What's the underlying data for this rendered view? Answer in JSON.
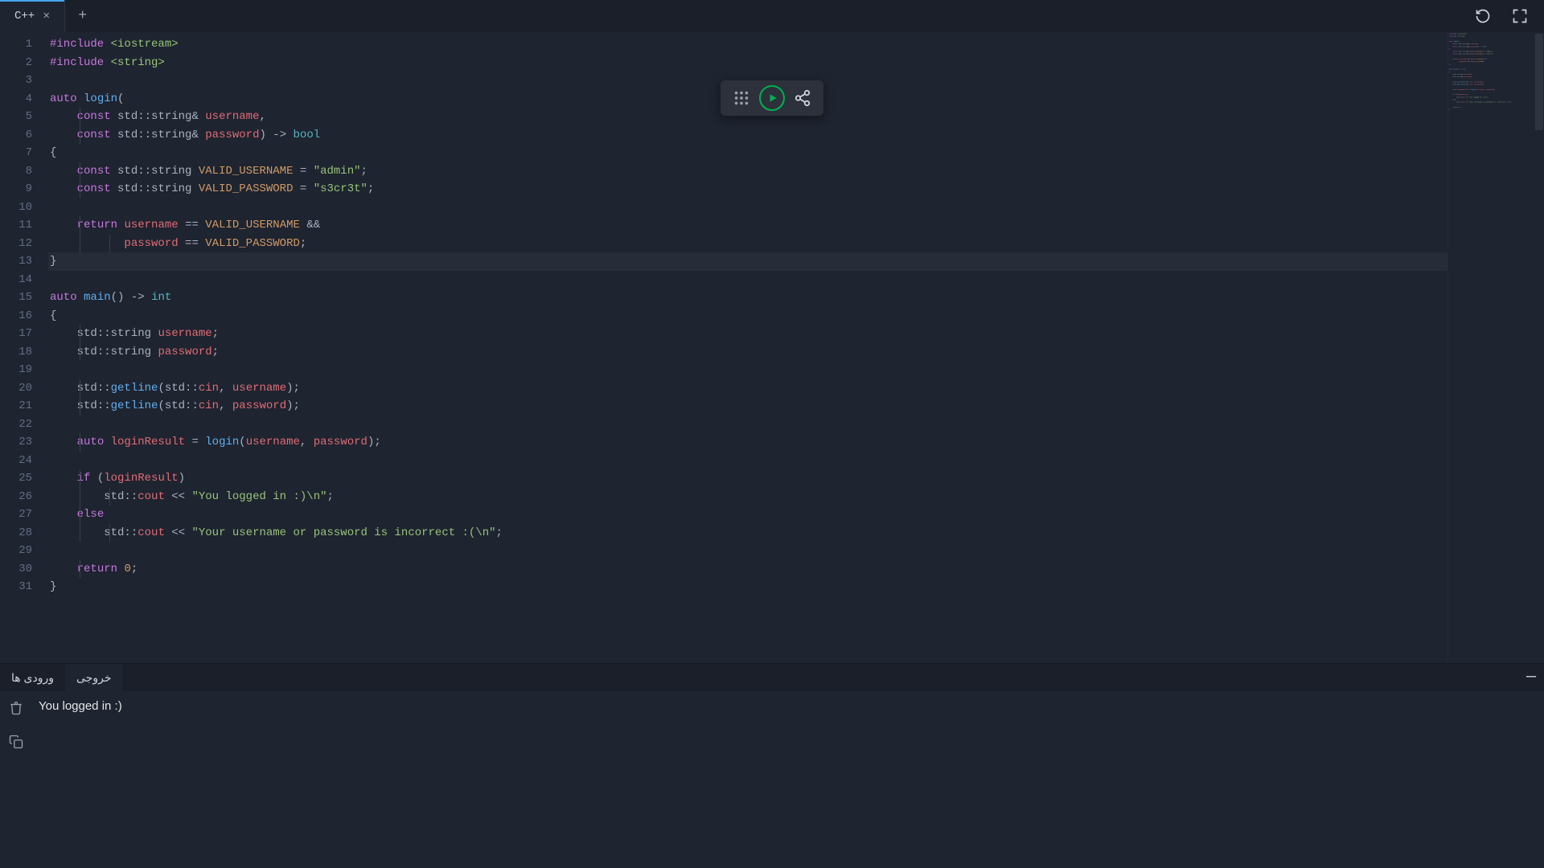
{
  "tabs": {
    "active": {
      "title": "C++"
    },
    "add_tooltip": "New Tab"
  },
  "toolbar": {
    "reload": "reload",
    "fullscreen": "fullscreen"
  },
  "float_actions": {
    "apps": "apps",
    "run": "run",
    "share": "share"
  },
  "panel": {
    "tab_inputs": "ورودی ها",
    "tab_output": "خروجی",
    "output_text": "You logged in :)"
  },
  "code": {
    "total_lines": 31,
    "current_line": 13,
    "lines": [
      [
        {
          "c": "tok-preproc",
          "t": "#include"
        },
        {
          "c": "",
          "t": " "
        },
        {
          "c": "tok-include-lib",
          "t": "<iostream>"
        }
      ],
      [
        {
          "c": "tok-preproc",
          "t": "#include"
        },
        {
          "c": "",
          "t": " "
        },
        {
          "c": "tok-include-lib",
          "t": "<string>"
        }
      ],
      [],
      [
        {
          "c": "tok-keyword",
          "t": "auto"
        },
        {
          "c": "",
          "t": " "
        },
        {
          "c": "tok-func",
          "t": "login"
        },
        {
          "c": "tok-punc",
          "t": "("
        }
      ],
      [
        {
          "c": "",
          "t": "    "
        },
        {
          "c": "tok-keyword",
          "t": "const"
        },
        {
          "c": "",
          "t": " "
        },
        {
          "c": "tok-ns",
          "t": "std::string"
        },
        {
          "c": "tok-op",
          "t": "&"
        },
        {
          "c": "",
          "t": " "
        },
        {
          "c": "tok-ident",
          "t": "username"
        },
        {
          "c": "tok-punc",
          "t": ","
        }
      ],
      [
        {
          "c": "",
          "t": "    "
        },
        {
          "c": "tok-keyword",
          "t": "const"
        },
        {
          "c": "",
          "t": " "
        },
        {
          "c": "tok-ns",
          "t": "std::string"
        },
        {
          "c": "tok-op",
          "t": "&"
        },
        {
          "c": "",
          "t": " "
        },
        {
          "c": "tok-ident",
          "t": "password"
        },
        {
          "c": "tok-punc",
          "t": ")"
        },
        {
          "c": "",
          "t": " "
        },
        {
          "c": "tok-op",
          "t": "->"
        },
        {
          "c": "",
          "t": " "
        },
        {
          "c": "tok-builtin-type",
          "t": "bool"
        }
      ],
      [
        {
          "c": "tok-punc",
          "t": "{"
        }
      ],
      [
        {
          "c": "",
          "t": "    "
        },
        {
          "c": "tok-keyword",
          "t": "const"
        },
        {
          "c": "",
          "t": " "
        },
        {
          "c": "tok-ns",
          "t": "std::string"
        },
        {
          "c": "",
          "t": " "
        },
        {
          "c": "tok-const",
          "t": "VALID_USERNAME"
        },
        {
          "c": "",
          "t": " "
        },
        {
          "c": "tok-op",
          "t": "="
        },
        {
          "c": "",
          "t": " "
        },
        {
          "c": "tok-string",
          "t": "\"admin\""
        },
        {
          "c": "tok-punc",
          "t": ";"
        }
      ],
      [
        {
          "c": "",
          "t": "    "
        },
        {
          "c": "tok-keyword",
          "t": "const"
        },
        {
          "c": "",
          "t": " "
        },
        {
          "c": "tok-ns",
          "t": "std::string"
        },
        {
          "c": "",
          "t": " "
        },
        {
          "c": "tok-const",
          "t": "VALID_PASSWORD"
        },
        {
          "c": "",
          "t": " "
        },
        {
          "c": "tok-op",
          "t": "="
        },
        {
          "c": "",
          "t": " "
        },
        {
          "c": "tok-string",
          "t": "\"s3cr3t\""
        },
        {
          "c": "tok-punc",
          "t": ";"
        }
      ],
      [],
      [
        {
          "c": "",
          "t": "    "
        },
        {
          "c": "tok-keyword",
          "t": "return"
        },
        {
          "c": "",
          "t": " "
        },
        {
          "c": "tok-ident",
          "t": "username"
        },
        {
          "c": "",
          "t": " "
        },
        {
          "c": "tok-op",
          "t": "=="
        },
        {
          "c": "",
          "t": " "
        },
        {
          "c": "tok-const",
          "t": "VALID_USERNAME"
        },
        {
          "c": "",
          "t": " "
        },
        {
          "c": "tok-op",
          "t": "&&"
        }
      ],
      [
        {
          "c": "",
          "t": "           "
        },
        {
          "c": "tok-ident",
          "t": "password"
        },
        {
          "c": "",
          "t": " "
        },
        {
          "c": "tok-op",
          "t": "=="
        },
        {
          "c": "",
          "t": " "
        },
        {
          "c": "tok-const",
          "t": "VALID_PASSWORD"
        },
        {
          "c": "tok-punc",
          "t": ";"
        }
      ],
      [
        {
          "c": "tok-punc",
          "t": "}"
        }
      ],
      [],
      [
        {
          "c": "tok-keyword",
          "t": "auto"
        },
        {
          "c": "",
          "t": " "
        },
        {
          "c": "tok-func",
          "t": "main"
        },
        {
          "c": "tok-punc",
          "t": "()"
        },
        {
          "c": "",
          "t": " "
        },
        {
          "c": "tok-op",
          "t": "->"
        },
        {
          "c": "",
          "t": " "
        },
        {
          "c": "tok-builtin-type",
          "t": "int"
        }
      ],
      [
        {
          "c": "tok-punc",
          "t": "{"
        }
      ],
      [
        {
          "c": "",
          "t": "    "
        },
        {
          "c": "tok-ns",
          "t": "std::string"
        },
        {
          "c": "",
          "t": " "
        },
        {
          "c": "tok-ident",
          "t": "username"
        },
        {
          "c": "tok-punc",
          "t": ";"
        }
      ],
      [
        {
          "c": "",
          "t": "    "
        },
        {
          "c": "tok-ns",
          "t": "std::string"
        },
        {
          "c": "",
          "t": " "
        },
        {
          "c": "tok-ident",
          "t": "password"
        },
        {
          "c": "tok-punc",
          "t": ";"
        }
      ],
      [],
      [
        {
          "c": "",
          "t": "    "
        },
        {
          "c": "tok-ns",
          "t": "std::"
        },
        {
          "c": "tok-func",
          "t": "getline"
        },
        {
          "c": "tok-punc",
          "t": "("
        },
        {
          "c": "tok-ns",
          "t": "std::"
        },
        {
          "c": "tok-ident",
          "t": "cin"
        },
        {
          "c": "tok-punc",
          "t": ","
        },
        {
          "c": "",
          "t": " "
        },
        {
          "c": "tok-ident",
          "t": "username"
        },
        {
          "c": "tok-punc",
          "t": ");"
        }
      ],
      [
        {
          "c": "",
          "t": "    "
        },
        {
          "c": "tok-ns",
          "t": "std::"
        },
        {
          "c": "tok-func",
          "t": "getline"
        },
        {
          "c": "tok-punc",
          "t": "("
        },
        {
          "c": "tok-ns",
          "t": "std::"
        },
        {
          "c": "tok-ident",
          "t": "cin"
        },
        {
          "c": "tok-punc",
          "t": ","
        },
        {
          "c": "",
          "t": " "
        },
        {
          "c": "tok-ident",
          "t": "password"
        },
        {
          "c": "tok-punc",
          "t": ");"
        }
      ],
      [],
      [
        {
          "c": "",
          "t": "    "
        },
        {
          "c": "tok-keyword",
          "t": "auto"
        },
        {
          "c": "",
          "t": " "
        },
        {
          "c": "tok-ident",
          "t": "loginResult"
        },
        {
          "c": "",
          "t": " "
        },
        {
          "c": "tok-op",
          "t": "="
        },
        {
          "c": "",
          "t": " "
        },
        {
          "c": "tok-func",
          "t": "login"
        },
        {
          "c": "tok-punc",
          "t": "("
        },
        {
          "c": "tok-ident",
          "t": "username"
        },
        {
          "c": "tok-punc",
          "t": ","
        },
        {
          "c": "",
          "t": " "
        },
        {
          "c": "tok-ident",
          "t": "password"
        },
        {
          "c": "tok-punc",
          "t": ");"
        }
      ],
      [],
      [
        {
          "c": "",
          "t": "    "
        },
        {
          "c": "tok-keyword",
          "t": "if"
        },
        {
          "c": "",
          "t": " "
        },
        {
          "c": "tok-punc",
          "t": "("
        },
        {
          "c": "tok-ident",
          "t": "loginResult"
        },
        {
          "c": "tok-punc",
          "t": ")"
        }
      ],
      [
        {
          "c": "",
          "t": "        "
        },
        {
          "c": "tok-ns",
          "t": "std::"
        },
        {
          "c": "tok-ident",
          "t": "cout"
        },
        {
          "c": "",
          "t": " "
        },
        {
          "c": "tok-op",
          "t": "<<"
        },
        {
          "c": "",
          "t": " "
        },
        {
          "c": "tok-string",
          "t": "\"You logged in :)\\n\""
        },
        {
          "c": "tok-punc",
          "t": ";"
        }
      ],
      [
        {
          "c": "",
          "t": "    "
        },
        {
          "c": "tok-keyword",
          "t": "else"
        }
      ],
      [
        {
          "c": "",
          "t": "        "
        },
        {
          "c": "tok-ns",
          "t": "std::"
        },
        {
          "c": "tok-ident",
          "t": "cout"
        },
        {
          "c": "",
          "t": " "
        },
        {
          "c": "tok-op",
          "t": "<<"
        },
        {
          "c": "",
          "t": " "
        },
        {
          "c": "tok-string",
          "t": "\"Your username or password is incorrect :(\\n\""
        },
        {
          "c": "tok-punc",
          "t": ";"
        }
      ],
      [],
      [
        {
          "c": "",
          "t": "    "
        },
        {
          "c": "tok-keyword",
          "t": "return"
        },
        {
          "c": "",
          "t": " "
        },
        {
          "c": "tok-const",
          "t": "0"
        },
        {
          "c": "tok-punc",
          "t": ";"
        }
      ],
      [
        {
          "c": "tok-punc",
          "t": "}"
        }
      ]
    ]
  }
}
